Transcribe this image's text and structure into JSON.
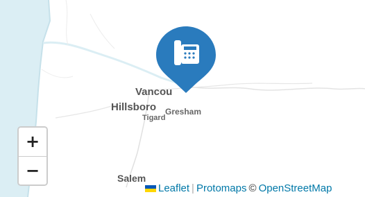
{
  "map": {
    "places": {
      "vancouver": "Vancou",
      "hillsboro": "Hillsboro",
      "gresham": "Gresham",
      "tigard": "Tigard",
      "salem": "Salem"
    },
    "marker": {
      "icon": "phone-icon",
      "color": "#2a7bbd"
    },
    "colors": {
      "water": "#dbeef4",
      "roads": "#d9d9d9",
      "boundaries": "#e3e3e3"
    }
  },
  "zoom": {
    "in_label": "+",
    "out_label": "−"
  },
  "attribution": {
    "leaflet": "Leaflet",
    "separator": "|",
    "protomaps": "Protomaps",
    "copyright": "©",
    "osm": "OpenStreetMap"
  }
}
